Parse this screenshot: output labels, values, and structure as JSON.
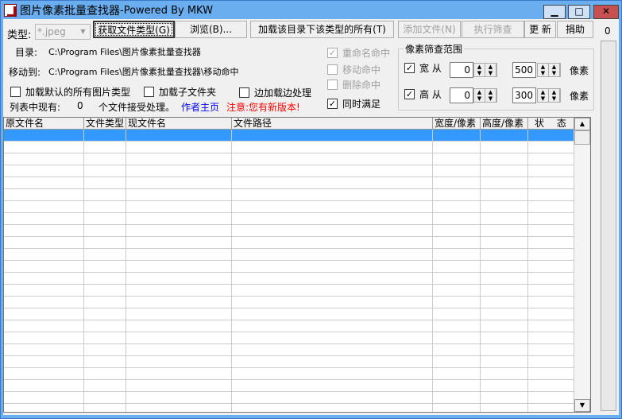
{
  "title": {
    "main": "图片像素批量查找器",
    "sub": "-Powered By MKW"
  },
  "toolbar": {
    "type_label": "类型:",
    "type_value": "*.jpeg",
    "get_types": "获取文件类型(G)",
    "browse": "浏览(B)...",
    "load_all": "加载该目录下该类型的所有(T)",
    "add_file": "添加文件(N)",
    "run_filter": "执行筛查",
    "update": "更 新",
    "donate": "捐助"
  },
  "side_counter": "0",
  "paths": {
    "dir_label": "目录:",
    "dir_value": "C:\\Program Files\\图片像素批量查找器",
    "move_label": "移动到:",
    "move_value": "C:\\Program Files\\图片像素批量查找器\\移动命中"
  },
  "options": {
    "load_default": "加载默认的所有图片类型",
    "load_sub": "加载子文件夹",
    "process_while": "边加载边处理",
    "rename_hit": "重命名命中",
    "move_hit": "移动命中",
    "delete_hit": "删除命中",
    "both": "同时满足"
  },
  "status": {
    "prefix": "列表中现有:",
    "count": "0",
    "suffix": "个文件接受处理。",
    "homepage": "作者主页",
    "notice": "注意:您有新版本!"
  },
  "filter": {
    "title": "像素筛查范围",
    "width_label": "宽 从",
    "width_from": "0",
    "width_to": "500",
    "height_label": "高 从",
    "height_from": "0",
    "height_to": "300",
    "unit": "像素"
  },
  "table": {
    "columns": [
      "原文件名",
      "文件类型",
      "现文件名",
      "文件路径",
      "宽度/像素",
      "高度/像素",
      "状　 态"
    ]
  }
}
